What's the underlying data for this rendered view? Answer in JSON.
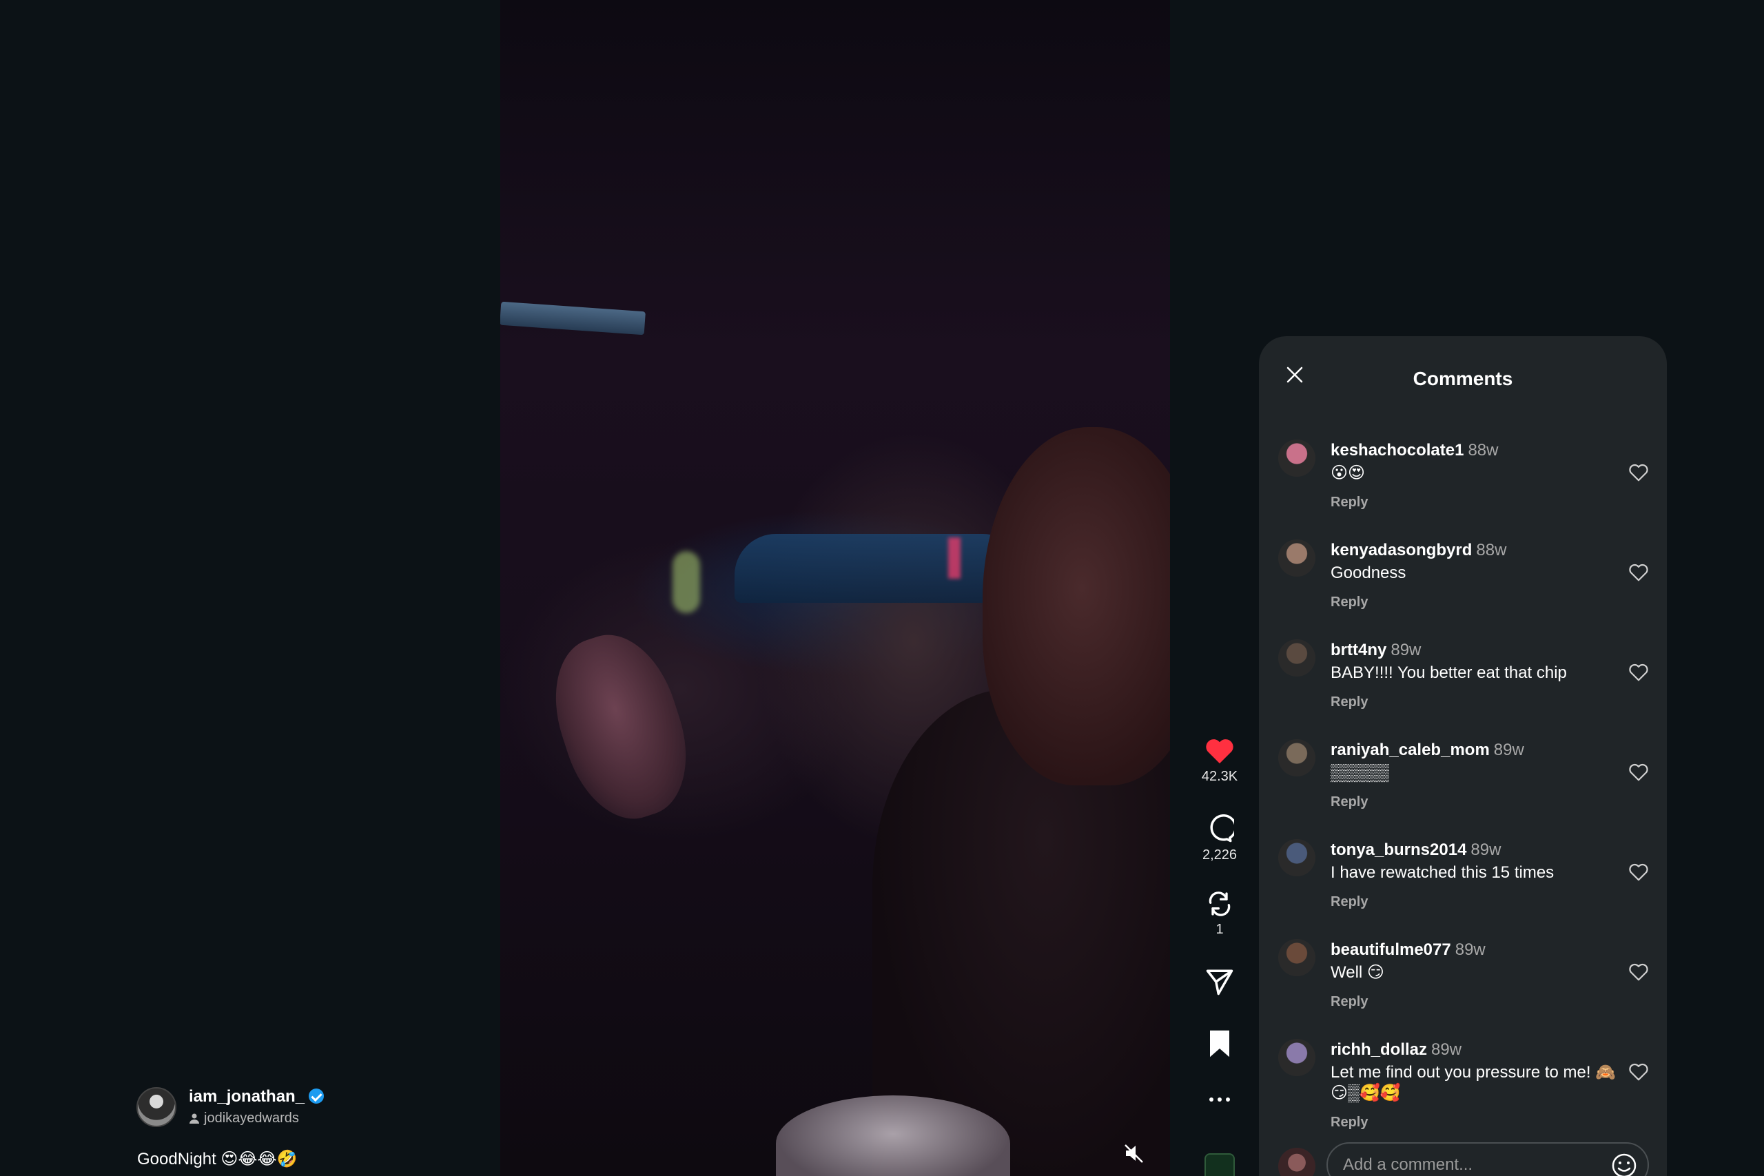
{
  "author": {
    "username": "iam_jonathan_",
    "collaborator": "jodikayedwards",
    "caption": "GoodNight 😍😂😂🤣"
  },
  "actions": {
    "likes": "42.3K",
    "comments": "2,226",
    "reposts": "1"
  },
  "panel": {
    "title": "Comments",
    "input_placeholder": "Add a comment..."
  },
  "comments": [
    {
      "username": "keshachocolate1",
      "time": "88w",
      "text": "😮😍",
      "reply": "Reply",
      "avatar_color": "#c9718a"
    },
    {
      "username": "kenyadasongbyrd",
      "time": "88w",
      "text": "Goodness",
      "reply": "Reply",
      "avatar_color": "#9a7a6a"
    },
    {
      "username": "brtt4ny",
      "time": "89w",
      "text": "BABY!!!! You better eat that chip",
      "reply": "Reply",
      "avatar_color": "#5a4a40"
    },
    {
      "username": "raniyah_caleb_mom",
      "time": "89w",
      "text": "▒▒▒▒▒",
      "reply": "Reply",
      "avatar_color": "#7a6a5a"
    },
    {
      "username": "tonya_burns2014",
      "time": "89w",
      "text": "I have rewatched this 15 times",
      "reply": "Reply",
      "avatar_color": "#4a5a7a"
    },
    {
      "username": "beautifulme077",
      "time": "89w",
      "text": "Well 😏",
      "reply": "Reply",
      "avatar_color": "#6a4a3a"
    },
    {
      "username": "richh_dollaz",
      "time": "89w",
      "text": "Let me find out you pressure to me! 🙈😏▒🥰🥰",
      "reply": "Reply",
      "avatar_color": "#8a7aaa"
    }
  ],
  "colors": {
    "background": "#0c1216",
    "panel": "#202528",
    "like_red": "#ff3040",
    "verified_blue": "#1d9bf0"
  }
}
